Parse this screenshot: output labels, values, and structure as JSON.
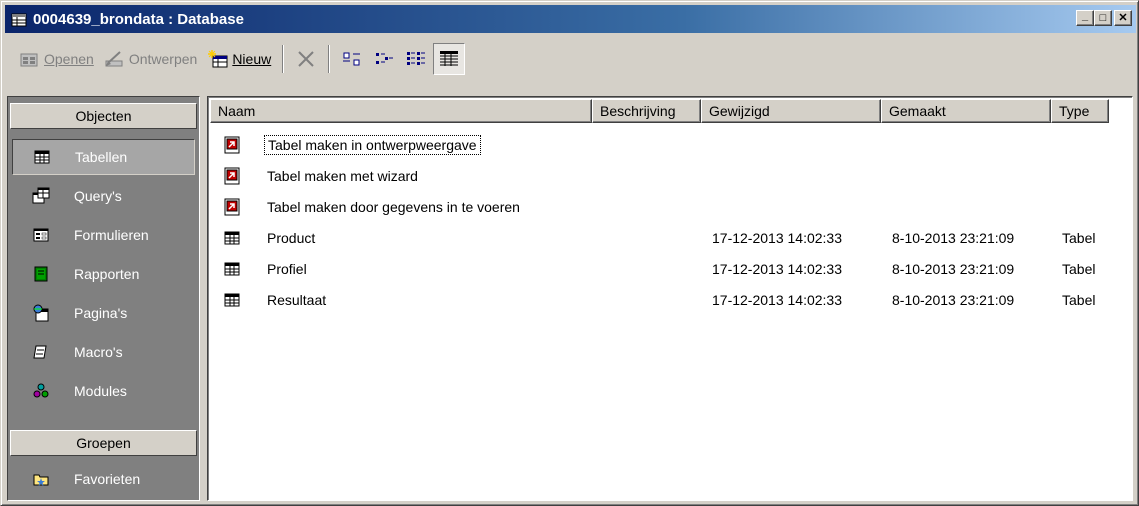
{
  "window": {
    "title": "0004639_brondata : Database",
    "controls": {
      "minimize": "_",
      "maximize": "□",
      "close": "✕"
    }
  },
  "toolbar": {
    "open_label": "Openen",
    "design_label": "Ontwerpen",
    "new_label": "Nieuw",
    "delete_icon": "delete-icon",
    "views": [
      "large-icons",
      "small-icons",
      "list",
      "details"
    ]
  },
  "sidebar": {
    "objects_header": "Objecten",
    "items": [
      {
        "label": "Tabellen",
        "icon": "table-icon",
        "selected": true
      },
      {
        "label": "Query's",
        "icon": "query-icon",
        "selected": false
      },
      {
        "label": "Formulieren",
        "icon": "form-icon",
        "selected": false
      },
      {
        "label": "Rapporten",
        "icon": "report-icon",
        "selected": false
      },
      {
        "label": "Pagina's",
        "icon": "page-icon",
        "selected": false
      },
      {
        "label": "Macro's",
        "icon": "macro-icon",
        "selected": false
      },
      {
        "label": "Modules",
        "icon": "module-icon",
        "selected": false
      }
    ],
    "groups_header": "Groepen",
    "groups": [
      {
        "label": "Favorieten",
        "icon": "favorites-icon"
      }
    ]
  },
  "list": {
    "columns": [
      "Naam",
      "Beschrijving",
      "Gewijzigd",
      "Gemaakt",
      "Type"
    ],
    "rows": [
      {
        "name": "Tabel maken in ontwerpweergave",
        "description": "",
        "modified": "",
        "created": "",
        "type": "",
        "icon": "shortcut-icon"
      },
      {
        "name": "Tabel maken met wizard",
        "description": "",
        "modified": "",
        "created": "",
        "type": "",
        "icon": "shortcut-icon"
      },
      {
        "name": "Tabel maken door gegevens in te voeren",
        "description": "",
        "modified": "",
        "created": "",
        "type": "",
        "icon": "shortcut-icon"
      },
      {
        "name": "Product",
        "description": "",
        "modified": "17-12-2013 14:02:33",
        "created": "8-10-2013 23:21:09",
        "type": "Tabel",
        "icon": "table-icon"
      },
      {
        "name": "Profiel",
        "description": "",
        "modified": "17-12-2013 14:02:33",
        "created": "8-10-2013 23:21:09",
        "type": "Tabel",
        "icon": "table-icon"
      },
      {
        "name": "Resultaat",
        "description": "",
        "modified": "17-12-2013 14:02:33",
        "created": "8-10-2013 23:21:09",
        "type": "Tabel",
        "icon": "table-icon"
      }
    ]
  }
}
